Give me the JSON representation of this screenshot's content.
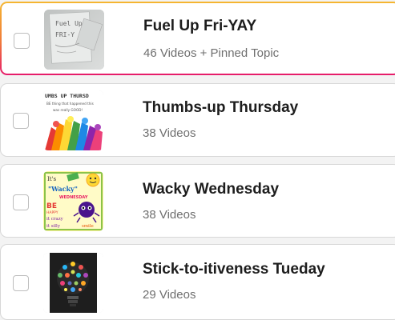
{
  "topics": [
    {
      "title": "Fuel Up Fri-YAY",
      "subtitle": "46 Videos + Pinned Topic",
      "selected": true,
      "thumb_icon": "handwritten-note-photo",
      "thumb_text": [
        "Fuel Up",
        "FRI-Y"
      ]
    },
    {
      "title": "Thumbs-up Thursday",
      "subtitle": "38 Videos",
      "selected": false,
      "thumb_icon": "thumbs-up-hands-illustration",
      "thumb_text": [
        "UMBS UP THURSD",
        "BE thing that happened this",
        "was really GOOD!"
      ]
    },
    {
      "title": "Wacky Wednesday",
      "subtitle": "38 Videos",
      "selected": false,
      "thumb_icon": "wacky-wednesday-poster",
      "thumb_text": [
        "It's",
        "\"Wacky\"",
        "WEDNESDAY",
        "BE",
        "HAPPY",
        "it crazy",
        "it silly",
        "smile"
      ]
    },
    {
      "title": "Stick-to-itiveness Tueday",
      "subtitle": "29 Videos",
      "selected": false,
      "thumb_icon": "lightbulb-icons-illustration",
      "thumb_text": []
    }
  ],
  "colors": {
    "selected_border_top": "#f5b731",
    "selected_border_bottom": "#e61b6b",
    "card_border": "#d7d7d7",
    "title": "#1d1d1d",
    "subtitle": "#6f6f6f"
  }
}
